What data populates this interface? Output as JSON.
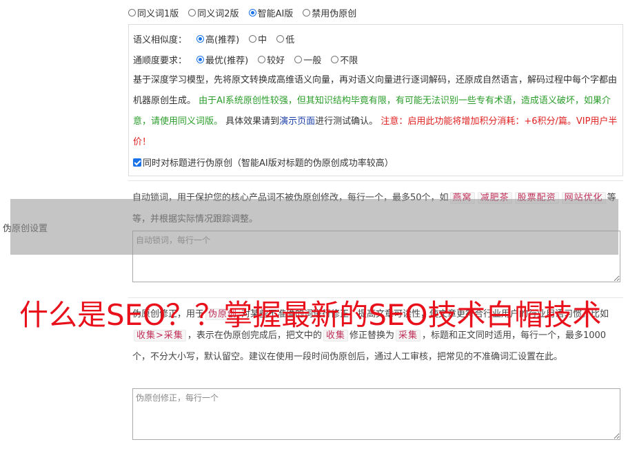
{
  "row_label": "伪原创设置",
  "modes": [
    {
      "label": "同义词1版",
      "checked": false
    },
    {
      "label": "同义词2版",
      "checked": false
    },
    {
      "label": "智能AI版",
      "checked": true
    },
    {
      "label": "禁用伪原创",
      "checked": false
    }
  ],
  "similarity": {
    "label": "语义相似度：",
    "options": [
      {
        "label": "高(推荐)",
        "checked": true
      },
      {
        "label": "中",
        "checked": false
      },
      {
        "label": "低",
        "checked": false
      }
    ]
  },
  "fluency": {
    "label": "通顺度要求：",
    "options": [
      {
        "label": "最优(推荐)",
        "checked": true
      },
      {
        "label": "较好",
        "checked": false
      },
      {
        "label": "一般",
        "checked": false
      },
      {
        "label": "不限",
        "checked": false
      }
    ]
  },
  "description": {
    "part1": "基于深度学习模型，先将原文转换成高维语义向量，再对语义向量进行逐词解码，还原成自然语言，解码过程中每个字都由机器原创生成。 ",
    "part2_green": "由于AI系统原创性较强，但其知识结构毕竟有限，有可能无法识别一些专有术语，造成语义破坏，如果介意，请使用同义词版。",
    "part3": " 具体效果请到",
    "link": "演示页面",
    "part4": "进行测试确认。 ",
    "part5_red": "注意：启用此功能将增加积分消耗：+6积分/篇。VIP用户半价！"
  },
  "title_checkbox": {
    "label": "同时对标题进行伪原创（智能AI版对标题的伪原创成功率较高）",
    "checked": true
  },
  "lock_section": {
    "intro": "自动锁词，用于保护您的核心产品词不被伪原创修改，每行一个，最多50个，如",
    "tags": [
      "燕窝",
      "减肥茶",
      "股票配资",
      "网站优化"
    ],
    "outro": "等等，并根据实际情况跟踪调整。",
    "placeholder": "自动锁词，每行一个"
  },
  "fix_section": {
    "intro": "伪原创修正，用于",
    "tag_a": "伪原创",
    "mid1": "对某些不准确的词进行修正，提高文章可读性，使文章更符合行业用户的行业用语习惯。比如",
    "tag_b": "收集>采集",
    "mid2": "，表示在伪原创完成后，把文中的",
    "tag_c": "收集",
    "mid3": "修正替换为",
    "tag_d": "采集",
    "mid4": "，标题和正文同时适用，每行一个，最多1000个，不分大小写，默认留空。建议在使用一段时间伪原创后，通过人工审核，把常见的不准确词汇设置在此。",
    "placeholder": "伪原创修正，每行一个"
  },
  "overlay_title": "什么是SEO？？掌握最新的SEO技术白帽技术",
  "colors": {
    "accent": "#1a73e8",
    "green": "#2a9d2a",
    "red": "#e02020",
    "link": "#1a3fa8",
    "overlay_red": "#e8101a"
  }
}
